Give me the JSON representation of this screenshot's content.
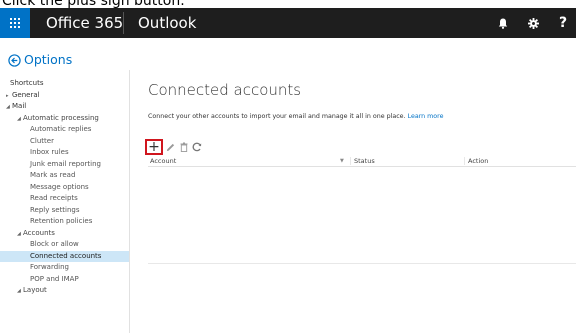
{
  "instruction": "Click the plus sign button.",
  "topbar": {
    "brand": "Office 365",
    "app_title": "Outlook",
    "bell_icon": "bell-icon",
    "gear_icon": "gear-icon",
    "help_label": "?"
  },
  "options": {
    "back_label": "Options"
  },
  "nav": {
    "items": [
      {
        "label": "Shortcuts",
        "level": 0,
        "caret": ""
      },
      {
        "label": "General",
        "level": 1,
        "caret": "▸"
      },
      {
        "label": "Mail",
        "level": 1,
        "caret": "◢"
      },
      {
        "label": "Automatic processing",
        "level": 2,
        "caret": "◢"
      },
      {
        "label": "Automatic replies",
        "level": 3,
        "caret": ""
      },
      {
        "label": "Clutter",
        "level": 3,
        "caret": ""
      },
      {
        "label": "Inbox rules",
        "level": 3,
        "caret": ""
      },
      {
        "label": "Junk email reporting",
        "level": 3,
        "caret": ""
      },
      {
        "label": "Mark as read",
        "level": 3,
        "caret": ""
      },
      {
        "label": "Message options",
        "level": 3,
        "caret": ""
      },
      {
        "label": "Read receipts",
        "level": 3,
        "caret": ""
      },
      {
        "label": "Reply settings",
        "level": 3,
        "caret": ""
      },
      {
        "label": "Retention policies",
        "level": 3,
        "caret": ""
      },
      {
        "label": "Accounts",
        "level": 2,
        "caret": "◢"
      },
      {
        "label": "Block or allow",
        "level": 3,
        "caret": ""
      },
      {
        "label": "Connected accounts",
        "level": 3,
        "caret": "",
        "selected": true
      },
      {
        "label": "Forwarding",
        "level": 3,
        "caret": ""
      },
      {
        "label": "POP and IMAP",
        "level": 3,
        "caret": ""
      },
      {
        "label": "Layout",
        "level": 2,
        "caret": "◢"
      }
    ]
  },
  "main": {
    "title": "Connected accounts",
    "description": "Connect your other accounts to import your email and manage it all in one place.",
    "learn_more": "Learn more",
    "toolbar": {
      "add_label": "+",
      "edit_icon": "pencil-icon",
      "delete_icon": "trash-icon",
      "refresh_icon": "refresh-icon"
    },
    "columns": {
      "account": "Account",
      "status": "Status",
      "action": "Action"
    }
  },
  "colors": {
    "accent": "#0072c6",
    "topbar": "#1e1e1e",
    "highlight": "#d0161e",
    "selected_bg": "#cde6f7"
  }
}
